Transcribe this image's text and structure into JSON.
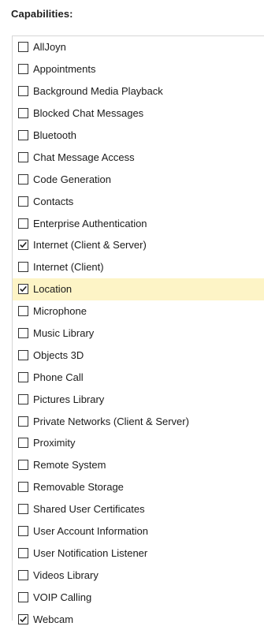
{
  "panel": {
    "title": "Capabilities:"
  },
  "colors": {
    "highlight": "#fdf4c6",
    "checkbox_border": "#333333",
    "text": "#1b1b1b"
  },
  "capabilities": [
    {
      "label": "AllJoyn",
      "checked": false
    },
    {
      "label": "Appointments",
      "checked": false
    },
    {
      "label": "Background Media Playback",
      "checked": false
    },
    {
      "label": "Blocked Chat Messages",
      "checked": false
    },
    {
      "label": "Bluetooth",
      "checked": false
    },
    {
      "label": "Chat Message Access",
      "checked": false
    },
    {
      "label": "Code Generation",
      "checked": false
    },
    {
      "label": "Contacts",
      "checked": false
    },
    {
      "label": "Enterprise Authentication",
      "checked": false
    },
    {
      "label": "Internet (Client & Server)",
      "checked": true
    },
    {
      "label": "Internet (Client)",
      "checked": false
    },
    {
      "label": "Location",
      "checked": true,
      "highlighted": true
    },
    {
      "label": "Microphone",
      "checked": false
    },
    {
      "label": "Music Library",
      "checked": false
    },
    {
      "label": "Objects 3D",
      "checked": false
    },
    {
      "label": "Phone Call",
      "checked": false
    },
    {
      "label": "Pictures Library",
      "checked": false
    },
    {
      "label": "Private Networks (Client & Server)",
      "checked": false
    },
    {
      "label": "Proximity",
      "checked": false
    },
    {
      "label": "Remote System",
      "checked": false
    },
    {
      "label": "Removable Storage",
      "checked": false
    },
    {
      "label": "Shared User Certificates",
      "checked": false
    },
    {
      "label": "User Account Information",
      "checked": false
    },
    {
      "label": "User Notification Listener",
      "checked": false
    },
    {
      "label": "Videos Library",
      "checked": false
    },
    {
      "label": "VOIP Calling",
      "checked": false
    },
    {
      "label": "Webcam",
      "checked": true
    }
  ]
}
